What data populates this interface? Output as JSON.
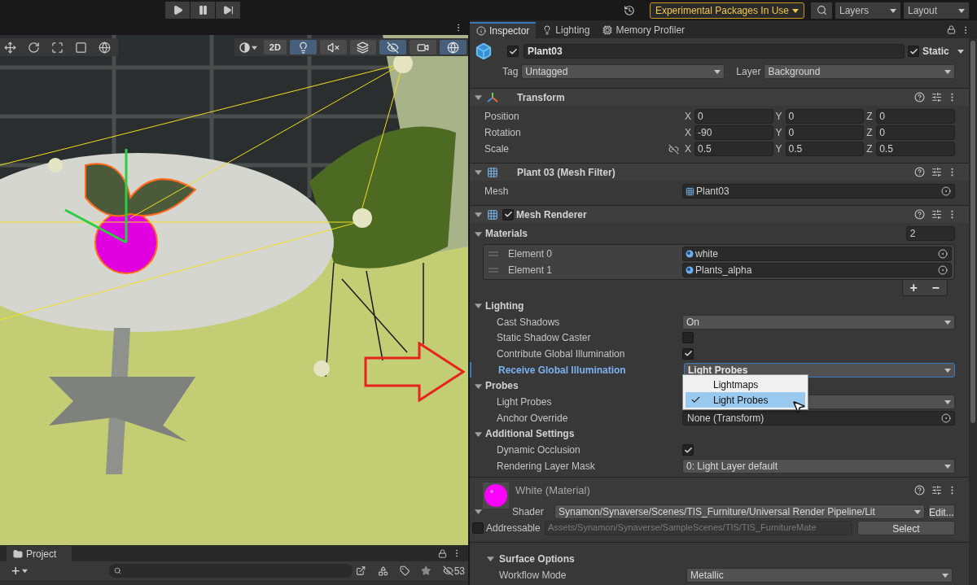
{
  "top_bar": {
    "play_controls": [
      {
        "kind": "play"
      },
      {
        "kind": "pause"
      },
      {
        "kind": "step"
      }
    ],
    "packages_button": "Experimental Packages In Use",
    "layers": "Layers",
    "layout": "Layout"
  },
  "scene": {
    "tools": [
      {
        "kind": "move"
      },
      {
        "kind": "rotate"
      },
      {
        "kind": "scale"
      },
      {
        "kind": "rect"
      },
      {
        "kind": "transform"
      }
    ],
    "mode_2d": "2D",
    "toggles": [
      {
        "kind": "lighting",
        "on": true
      },
      {
        "kind": "audio",
        "on": false
      },
      {
        "kind": "effects",
        "on": false
      },
      {
        "kind": "hidden",
        "on": true
      },
      {
        "kind": "camera",
        "on": false
      },
      {
        "kind": "gizmos",
        "on": true
      }
    ]
  },
  "inspector": {
    "tabs": [
      {
        "label": "Inspector",
        "kind": "info",
        "selected": true
      },
      {
        "label": "Lighting",
        "kind": "light",
        "selected": false
      },
      {
        "label": "Memory Profiler",
        "kind": "memory",
        "selected": false
      }
    ],
    "object": {
      "active": true,
      "name": "Plant03",
      "static": true,
      "static_label": "Static",
      "tag_label": "Tag",
      "tag": "Untagged",
      "layer_label": "Layer",
      "layer": "Background"
    },
    "transform": {
      "title": "Transform",
      "rows": [
        {
          "label": "Position",
          "link": false,
          "values": [
            {
              "axis": "X",
              "value": "0"
            },
            {
              "axis": "Y",
              "value": "0"
            },
            {
              "axis": "Z",
              "value": "0"
            }
          ]
        },
        {
          "label": "Rotation",
          "link": false,
          "values": [
            {
              "axis": "X",
              "value": "-90"
            },
            {
              "axis": "Y",
              "value": "0"
            },
            {
              "axis": "Z",
              "value": "0"
            }
          ]
        },
        {
          "label": "Scale",
          "link": true,
          "values": [
            {
              "axis": "X",
              "value": "0.5"
            },
            {
              "axis": "Y",
              "value": "0.5"
            },
            {
              "axis": "Z",
              "value": "0.5"
            }
          ]
        }
      ]
    },
    "mesh_filter": {
      "title": "Plant 03 (Mesh Filter)",
      "mesh_label": "Mesh",
      "mesh": "Plant03"
    },
    "mesh_renderer": {
      "enabled": true,
      "title": "Mesh Renderer",
      "materials": {
        "label": "Materials",
        "count": "2",
        "elements": [
          {
            "label": "Element 0",
            "value": "white"
          },
          {
            "label": "Element 1",
            "value": "Plants_alpha"
          }
        ],
        "add": "+",
        "remove": "−"
      },
      "sections": [
        {
          "title": "Lighting",
          "rows": [
            {
              "kind": "dropdown",
              "label": "Cast Shadows",
              "value": "On",
              "focused": false
            },
            {
              "kind": "checkbox",
              "label": "Static Shadow Caster",
              "checked": false
            },
            {
              "kind": "checkbox",
              "label": "Contribute Global Illumination",
              "checked": true
            },
            {
              "kind": "dropdown",
              "label": "Receive Global Illumination",
              "value": "Light Probes",
              "focused": true
            }
          ]
        },
        {
          "title": "Probes",
          "rows": [
            {
              "kind": "dropdown",
              "label": "Light Probes",
              "focused": false
            },
            {
              "kind": "object",
              "label": "Anchor Override",
              "value": "None (Transform)"
            }
          ]
        },
        {
          "title": "Additional Settings",
          "rows": [
            {
              "kind": "checkbox",
              "label": "Dynamic Occlusion",
              "checked": true
            },
            {
              "kind": "dropdown",
              "label": "Rendering Layer Mask",
              "value": "0: Light Layer default",
              "focused": false
            }
          ]
        }
      ]
    },
    "popup": {
      "options": [
        {
          "label": "Lightmaps",
          "selected": false
        },
        {
          "label": "Light Probes",
          "selected": true
        }
      ]
    },
    "material": {
      "title": "White (Material)",
      "shader_label": "Shader",
      "shader": "Synamon/Synaverse/Scenes/TIS_Furniture/Universal Render Pipeline/Lit",
      "edit": "Edit...",
      "addressable_label": "Addressable",
      "addressable": false,
      "path": "Assets/Synamon/Synaverse/SampleScenes/TIS/TIS_FurnitureMate",
      "select": "Select",
      "surface_title": "Surface Options",
      "surface_rows": [
        {
          "label": "Workflow Mode",
          "value": "Metallic"
        }
      ]
    }
  },
  "project": {
    "tab": "Project",
    "add": "+",
    "hidden_count": "53"
  }
}
